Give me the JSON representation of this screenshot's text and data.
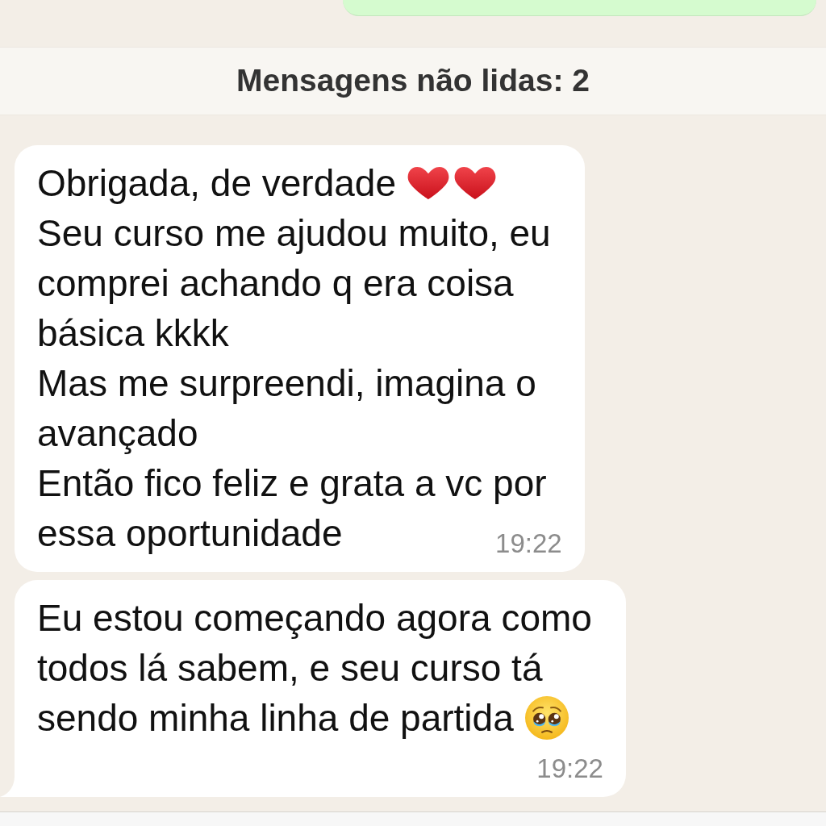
{
  "unread_banner": {
    "text": "Mensagens não lidas: 2"
  },
  "messages": [
    {
      "tail": false,
      "lines": [
        {
          "text": "Obrigada, de verdade",
          "emoji": [
            {
              "kind": "heart"
            },
            {
              "kind": "heart"
            }
          ]
        },
        {
          "text": "Seu curso me ajudou muito, eu"
        },
        {
          "text": "comprei achando q era coisa"
        },
        {
          "text": "básica kkkk"
        },
        {
          "text": "Mas me surpreendi, imagina o"
        },
        {
          "text": "avançado"
        },
        {
          "text": "Então fico feliz e grata a vc por"
        },
        {
          "text": "essa oportunidade"
        }
      ],
      "time": "19:22"
    },
    {
      "tail": true,
      "lines": [
        {
          "text": "Eu estou começando agora como"
        },
        {
          "text": "todos lá sabem, e seu curso tá"
        },
        {
          "text": "sendo minha linha de partida",
          "emoji": [
            {
              "kind": "teary_face"
            }
          ]
        }
      ],
      "time": "19:22"
    }
  ]
}
